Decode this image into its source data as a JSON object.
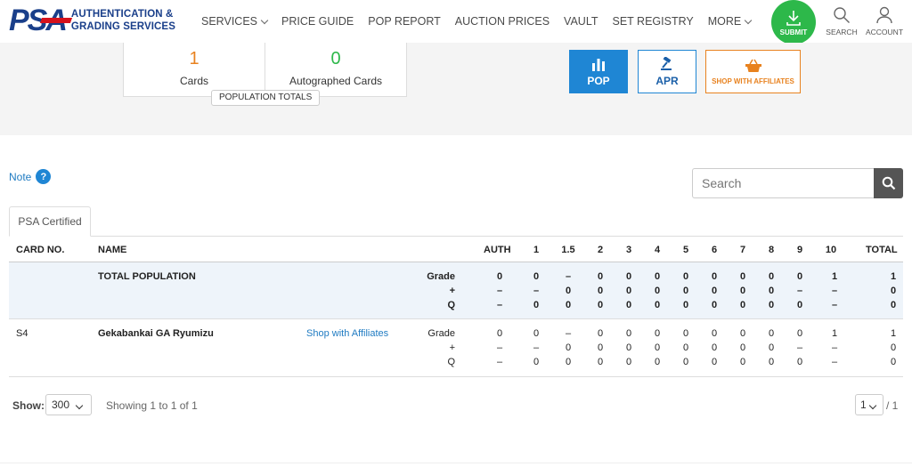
{
  "header": {
    "logo": "PSA",
    "logo_line1": "AUTHENTICATION &",
    "logo_line2": "GRADING SERVICES",
    "nav": [
      "SERVICES",
      "PRICE GUIDE",
      "POP REPORT",
      "AUCTION PRICES",
      "VAULT",
      "SET REGISTRY",
      "MORE"
    ],
    "submit_label": "SUBMIT",
    "search_label": "SEARCH",
    "account_label": "ACCOUNT"
  },
  "stats": {
    "cards_count": "1",
    "cards_label": "Cards",
    "auto_count": "0",
    "auto_label": "Autographed Cards",
    "population_totals": "POPULATION TOTALS"
  },
  "quick_links": {
    "pop": "POP",
    "apr": "APR",
    "shop": "SHOP WITH AFFILIATES"
  },
  "note_label": "Note",
  "search": {
    "placeholder": "Search"
  },
  "tab_label": "PSA Certified",
  "table": {
    "headers": [
      "CARD NO.",
      "NAME",
      "AUTH",
      "1",
      "1.5",
      "2",
      "3",
      "4",
      "5",
      "6",
      "7",
      "8",
      "9",
      "10",
      "TOTAL"
    ],
    "totals_row": {
      "name": "TOTAL POPULATION",
      "labels": [
        "Grade",
        "+",
        "Q"
      ],
      "grade": [
        "0",
        "0",
        "–",
        "0",
        "0",
        "0",
        "0",
        "0",
        "0",
        "0",
        "0",
        "1",
        "1"
      ],
      "plus": [
        "–",
        "–",
        "0",
        "0",
        "0",
        "0",
        "0",
        "0",
        "0",
        "0",
        "–",
        "–",
        "0"
      ],
      "q": [
        "–",
        "0",
        "0",
        "0",
        "0",
        "0",
        "0",
        "0",
        "0",
        "0",
        "0",
        "–",
        "0"
      ]
    },
    "rows": [
      {
        "card_no": "S4",
        "name": "Gekabankai GA Ryumizu",
        "shop_link": "Shop with Affiliates",
        "labels": [
          "Grade",
          "+",
          "Q"
        ],
        "grade": [
          "0",
          "0",
          "–",
          "0",
          "0",
          "0",
          "0",
          "0",
          "0",
          "0",
          "0",
          "1",
          "1"
        ],
        "plus": [
          "–",
          "–",
          "0",
          "0",
          "0",
          "0",
          "0",
          "0",
          "0",
          "0",
          "–",
          "–",
          "0"
        ],
        "q": [
          "–",
          "0",
          "0",
          "0",
          "0",
          "0",
          "0",
          "0",
          "0",
          "0",
          "0",
          "–",
          "0"
        ]
      }
    ]
  },
  "footer": {
    "show_label": "Show:",
    "page_size": "300",
    "showing_text": "Showing 1 to 1 of 1",
    "page": "1",
    "page_total": "/ 1"
  },
  "colors": {
    "brand_blue": "#1a3f8a",
    "brand_red": "#d6121c",
    "submit_green": "#2db84a",
    "pop_blue": "#1f86d4",
    "shop_orange": "#e8821f",
    "cards_orange": "#e8821f",
    "auto_green": "#2db84a"
  }
}
